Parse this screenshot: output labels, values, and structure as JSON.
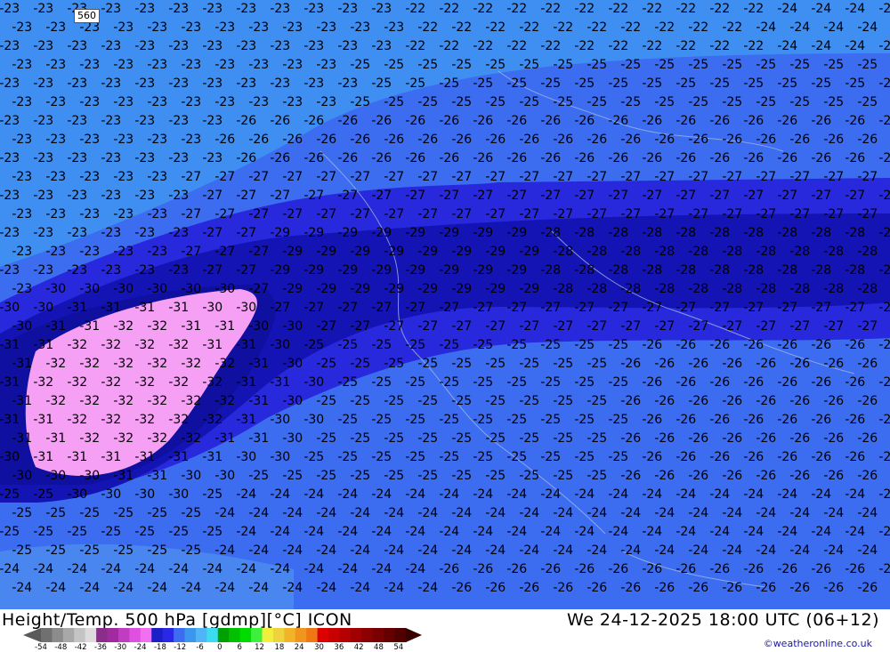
{
  "map": {
    "height_label": "560",
    "isotherm_labels": [
      "-22",
      "-23",
      "-24",
      "-25",
      "-26",
      "-27",
      "-28",
      "-29",
      "-30",
      "-31",
      "-32"
    ]
  },
  "footer": {
    "title": "Height/Temp. 500 hPa [gdmp][°C] ICON",
    "datetime": "We 24-12-2025 18:00 UTC (06+12)",
    "credit": "©weatheronline.co.uk"
  },
  "colorbar": {
    "labels": [
      "-54",
      "-48",
      "-42",
      "-36",
      "-30",
      "-24",
      "-18",
      "-12",
      "-6",
      "0",
      "6",
      "12",
      "18",
      "24",
      "30",
      "36",
      "42",
      "48",
      "54"
    ],
    "colors": [
      "#707070",
      "#8c8c8c",
      "#a8a8a8",
      "#c4c4c4",
      "#dcdcdc",
      "#8b2d8b",
      "#a02aa0",
      "#c03cc0",
      "#e050e0",
      "#f070f0",
      "#1e1ec8",
      "#2828e6",
      "#3c6cf0",
      "#3c96f0",
      "#50b4f5",
      "#3cdcf0",
      "#00a000",
      "#00c000",
      "#00dc00",
      "#3cf03c",
      "#f0f03c",
      "#f0d23c",
      "#f0b428",
      "#f0961e",
      "#f07814",
      "#dc0000",
      "#c80000",
      "#b40000",
      "#a00000",
      "#8c0000",
      "#780000",
      "#640000",
      "#500000"
    ]
  }
}
